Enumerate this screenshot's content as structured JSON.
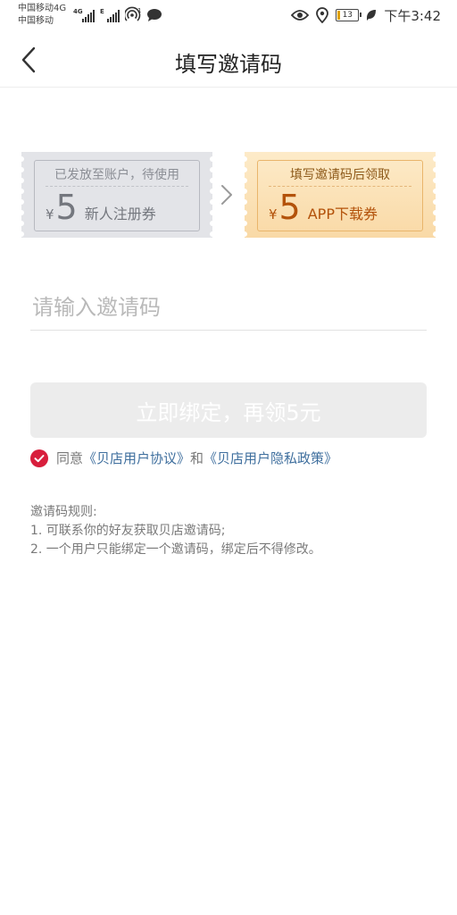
{
  "status_bar": {
    "carrier_1": "中国移动4G",
    "carrier_2": "中国移动",
    "signal_1_label": "4G",
    "signal_2_label": "E",
    "wifi_badge": "1",
    "battery_level": "13",
    "time": "下午3:42",
    "icons": [
      "eye-icon",
      "location-icon",
      "battery-icon",
      "leaf-icon"
    ]
  },
  "nav": {
    "back_icon": "chevron-left-icon",
    "title": "填写邀请码"
  },
  "coupons": {
    "issued": {
      "header": "已发放至账户，待使用",
      "currency": "¥",
      "amount": "5",
      "name": "新人注册券"
    },
    "arrow_icon": "chevron-right-icon",
    "pending": {
      "header": "填写邀请码后领取",
      "currency": "¥",
      "amount": "5",
      "name": "APP下载券"
    }
  },
  "form": {
    "invite_value": "",
    "invite_placeholder": "请输入邀请码",
    "bind_button": "立即绑定，再领5元"
  },
  "agreement": {
    "agreed": true,
    "prefix": "同意",
    "link_1": "《贝店用户协议》",
    "joiner": "和",
    "link_2": "《贝店用户隐私政策》"
  },
  "rules": {
    "title": "邀请码规则:",
    "items": [
      "1. 可联系你的好友获取贝店邀请码;",
      "2. 一个用户只能绑定一个邀请码，绑定后不得修改。"
    ]
  },
  "colors": {
    "accent_red": "#d81e3c",
    "link_blue": "#3f6f9e",
    "coupon_gold": "#fbe3bd",
    "coupon_grey": "#e3e4e8"
  }
}
